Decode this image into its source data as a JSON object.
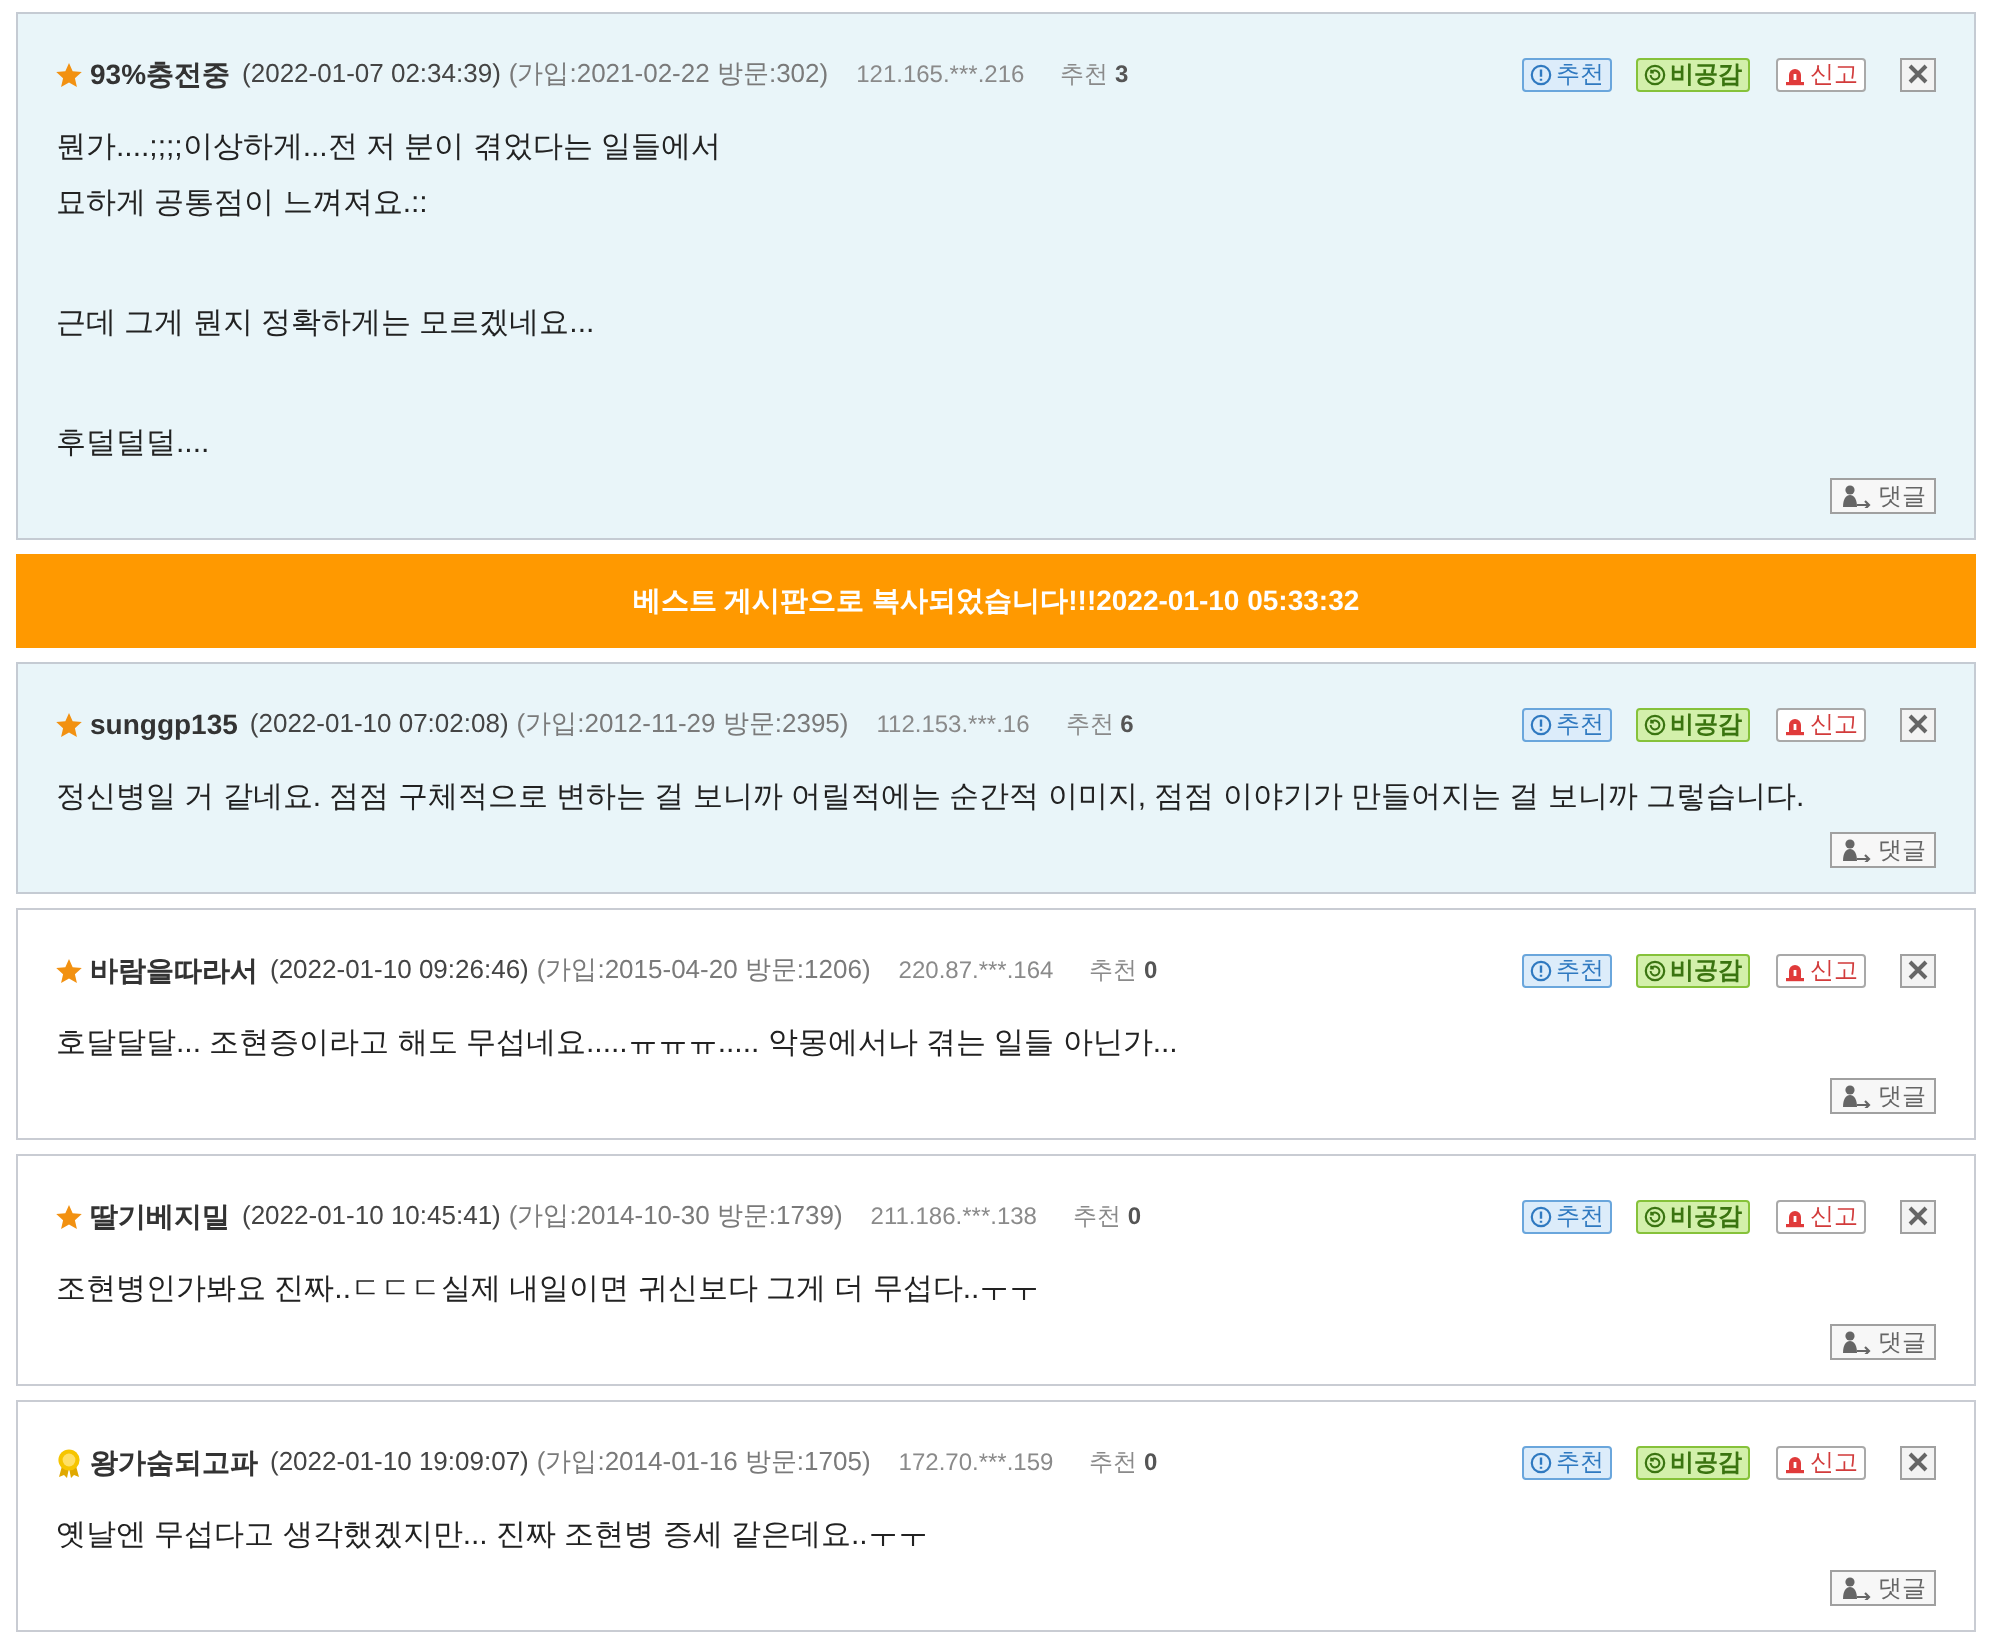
{
  "items": [
    {
      "kind": "comment",
      "highlighted": true,
      "badge": {
        "kind": "star"
      },
      "author": "93%충전중",
      "date": "(2022-01-07 02:34:39)",
      "member_info": "(가입:2021-02-22 방문:302)",
      "ip": "121.165.***.216",
      "recommend": "추천 **3**",
      "actions": [
        {
          "kind": "upvote",
          "label": "추천"
        },
        {
          "kind": "dislike",
          "label": "비공감"
        },
        {
          "kind": "report",
          "label": "신고"
        }
      ],
      "paragraphs": [
        [
          "뭔가....;;;;이상하게...전 저 분이 겪었다는 일들에서",
          "묘하게 공통점이 느껴져요.::"
        ],
        [
          "근데 그게 뭔지 정확하게는 모르겠네요..."
        ],
        [
          "후덜덜덜...."
        ]
      ],
      "reply_label": "댓글"
    },
    {
      "kind": "notice",
      "text": "베스트 게시판으로 복사되었습니다!!!2022-01-10 05:33:32"
    },
    {
      "kind": "comment",
      "highlighted": true,
      "badge": {
        "kind": "star"
      },
      "author": "sunggp135",
      "date": "(2022-01-10 07:02:08)",
      "member_info": "(가입:2012-11-29 방문:2395)",
      "ip": "112.153.***.16",
      "recommend": "추천 **6**",
      "actions": [
        {
          "kind": "upvote",
          "label": "추천"
        },
        {
          "kind": "dislike",
          "label": "비공감"
        },
        {
          "kind": "report",
          "label": "신고"
        }
      ],
      "paragraphs": [
        [
          "정신병일 거 같네요. 점점 구체적으로 변하는 걸 보니까 어릴적에는 순간적 이미지, 점점 이야기가 만들어지는 걸 보니까 그렇습니다."
        ]
      ],
      "reply_label": "댓글"
    },
    {
      "kind": "comment",
      "highlighted": false,
      "badge": {
        "kind": "star"
      },
      "author": "바람을따라서",
      "date": "(2022-01-10 09:26:46)",
      "member_info": "(가입:2015-04-20 방문:1206)",
      "ip": "220.87.***.164",
      "recommend": "추천 **0**",
      "actions": [
        {
          "kind": "upvote",
          "label": "추천"
        },
        {
          "kind": "dislike",
          "label": "비공감"
        },
        {
          "kind": "report",
          "label": "신고"
        }
      ],
      "paragraphs": [
        [
          "호달달달... 조현증이라고 해도 무섭네요.....ㅠㅠㅠ..... 악몽에서나 겪는 일들 아닌가..."
        ]
      ],
      "reply_label": "댓글"
    },
    {
      "kind": "comment",
      "highlighted": false,
      "badge": {
        "kind": "star"
      },
      "author": "딸기베지밀",
      "date": "(2022-01-10 10:45:41)",
      "member_info": "(가입:2014-10-30 방문:1739)",
      "ip": "211.186.***.138",
      "recommend": "추천 **0**",
      "actions": [
        {
          "kind": "upvote",
          "label": "추천"
        },
        {
          "kind": "dislike",
          "label": "비공감"
        },
        {
          "kind": "report",
          "label": "신고"
        }
      ],
      "paragraphs": [
        [
          "조현병인가봐요 진짜..ㄷㄷㄷ실제 내일이면 귀신보다 그게 더 무섭다..ㅜㅜ"
        ]
      ],
      "reply_label": "댓글"
    },
    {
      "kind": "comment",
      "highlighted": false,
      "badge": {
        "kind": "medal"
      },
      "author": "왕가숨되고파",
      "date": "(2022-01-10 19:09:07)",
      "member_info": "(가입:2014-01-16 방문:1705)",
      "ip": "172.70.***.159",
      "recommend": "추천 **0**",
      "actions": [
        {
          "kind": "upvote",
          "label": "추천"
        },
        {
          "kind": "dislike",
          "label": "비공감"
        },
        {
          "kind": "report",
          "label": "신고"
        }
      ],
      "paragraphs": [
        [
          "옛날엔 무섭다고 생각했겠지만... 진짜 조현병 증세 같은데요..ㅜㅜ"
        ]
      ],
      "reply_label": "댓글"
    }
  ]
}
